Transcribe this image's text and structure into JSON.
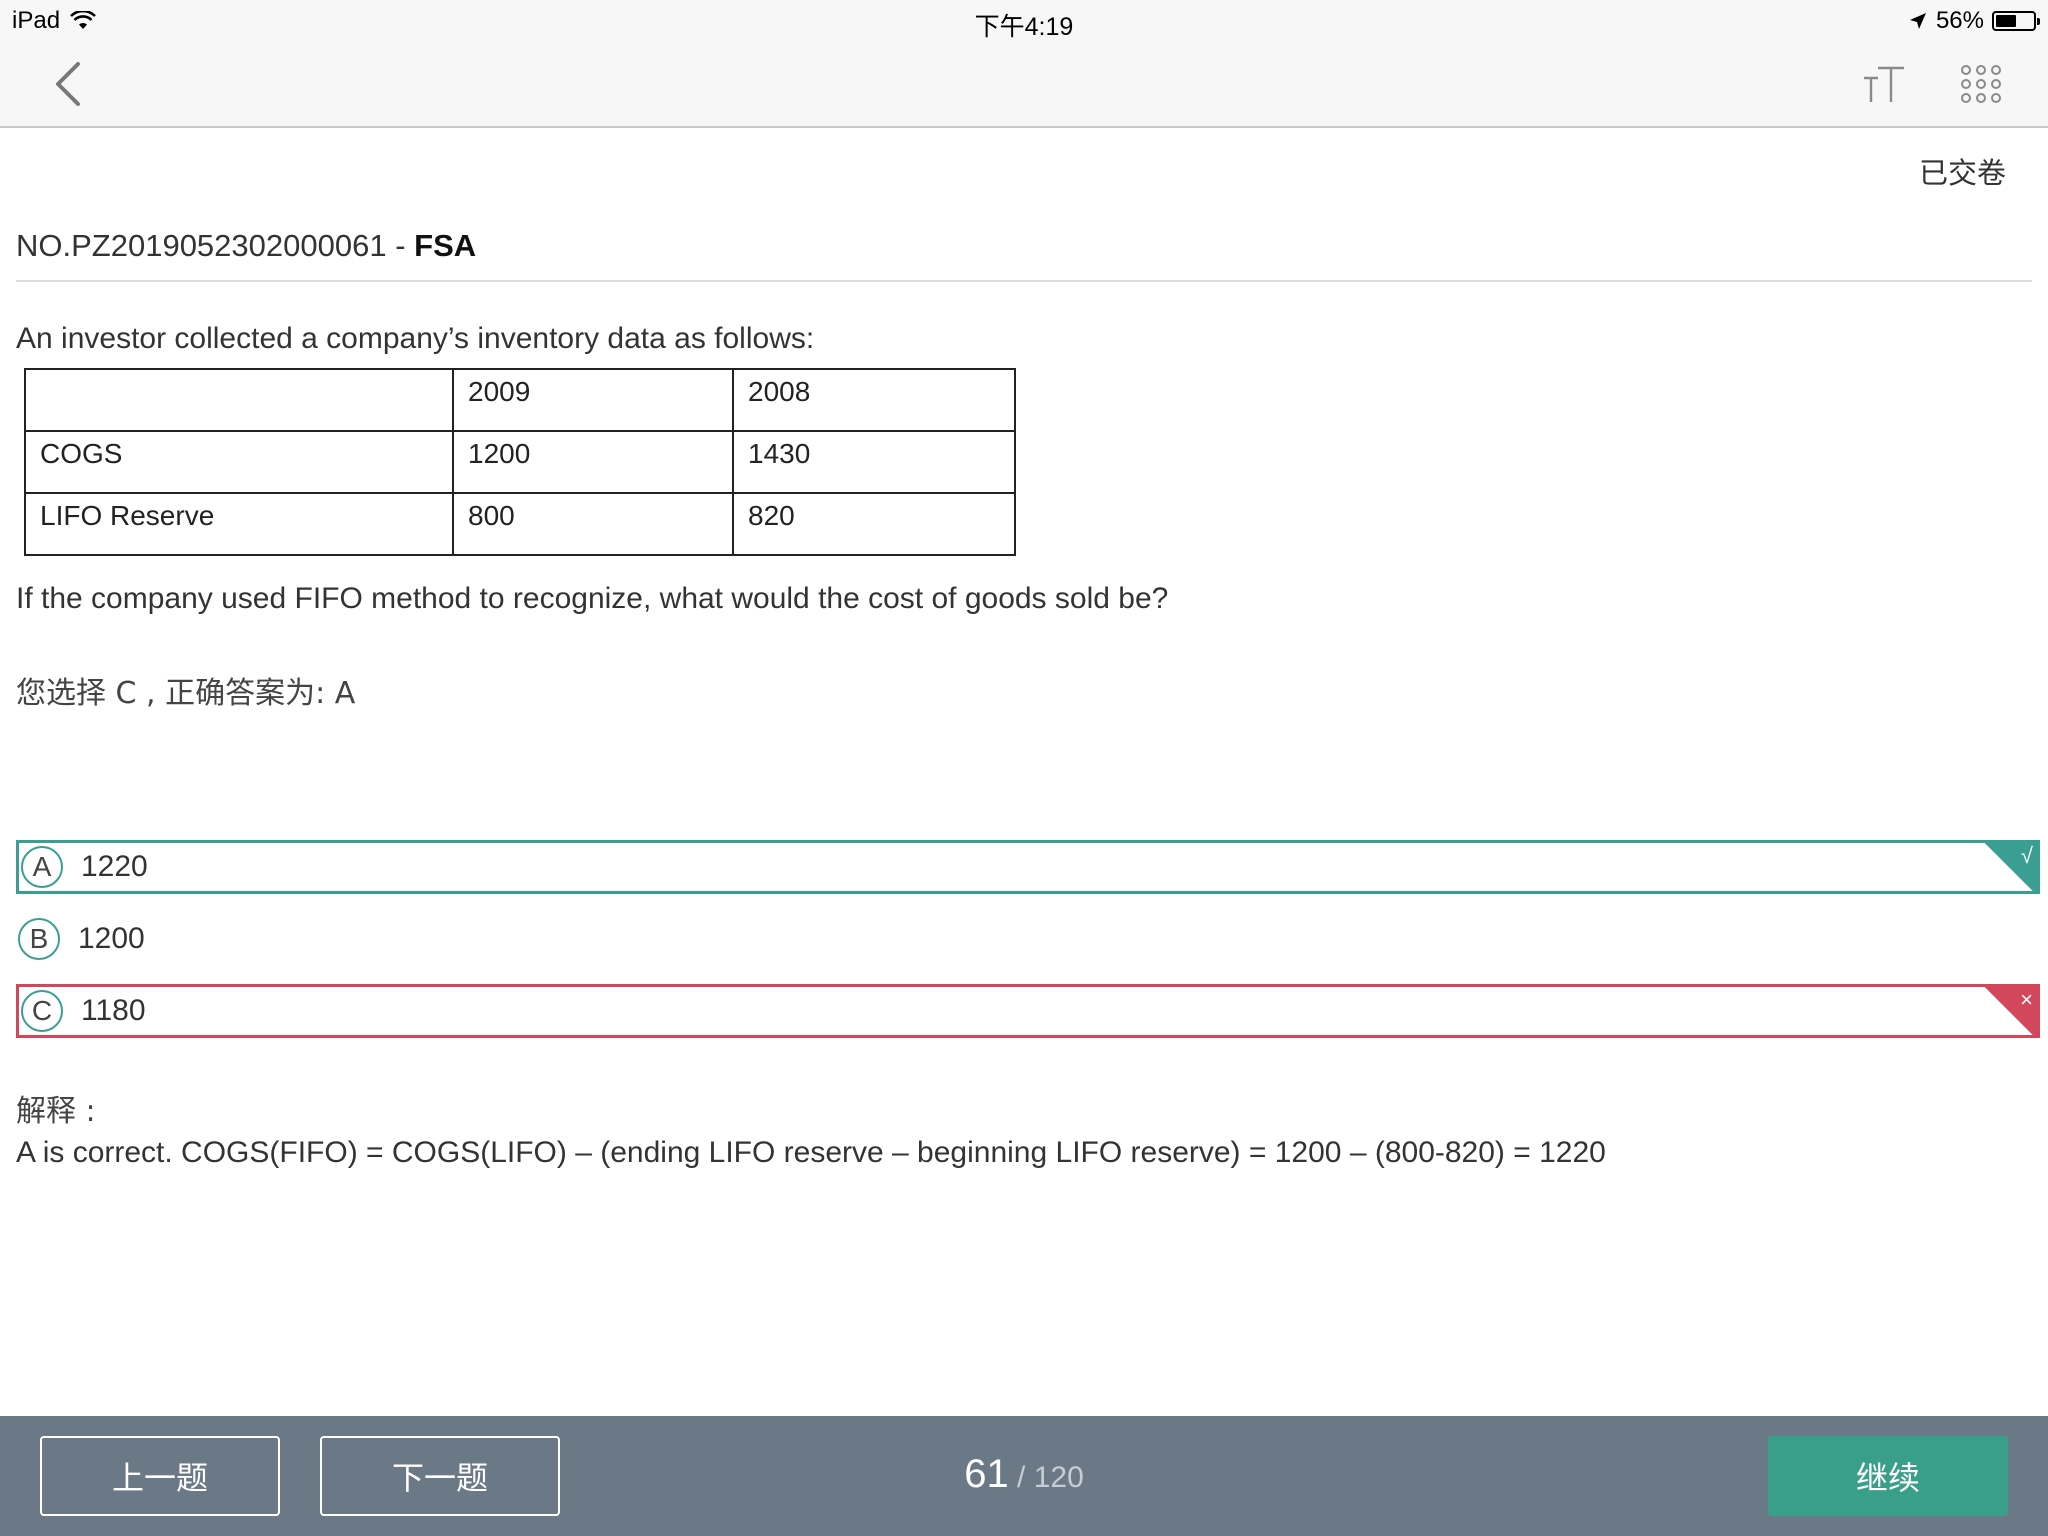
{
  "status_bar": {
    "device": "iPad",
    "time": "下午4:19",
    "battery": "56%",
    "battery_level": 0.56
  },
  "header": {
    "submitted_label": "已交卷"
  },
  "question": {
    "number": "NO.PZ2019052302000061 - ",
    "subject": "FSA",
    "stem": "An investor collected a company’s inventory data as follows:",
    "table": [
      [
        "",
        "2009",
        "2008"
      ],
      [
        "COGS",
        "1200",
        "1430"
      ],
      [
        "LIFO Reserve",
        "800",
        "820"
      ]
    ],
    "prompt": "If the company used FIFO method to recognize, what would the cost of goods sold be?",
    "answer_line": "您选择 C , 正确答案为: A"
  },
  "options": [
    {
      "letter": "A",
      "value": "1220",
      "mark": "√"
    },
    {
      "letter": "B",
      "value": "1200"
    },
    {
      "letter": "C",
      "value": "1180",
      "mark": "×"
    }
  ],
  "explanation": {
    "label": "解释 :",
    "text": "A is correct. COGS(FIFO) = COGS(LIFO) – (ending LIFO reserve – beginning LIFO reserve) = 1200 – (800-820) = 1220"
  },
  "footer": {
    "prev_label": "上一题",
    "next_label": "下一题",
    "current": "61",
    "total": " / 120",
    "continue_label": "继续"
  },
  "colors": {
    "correct": "#3a9f92",
    "wrong": "#d2475b",
    "bottom_bar": "#6b7987",
    "continue": "#3a9f88"
  },
  "icons": {
    "back": "chevron-left-icon",
    "font_size": "text-size-icon",
    "grid": "grid-icon",
    "wifi": "wifi-icon",
    "location": "location-arrow-icon",
    "battery": "battery-icon"
  }
}
